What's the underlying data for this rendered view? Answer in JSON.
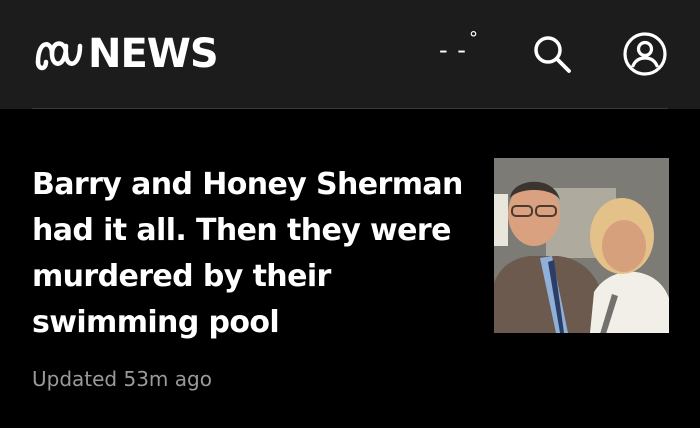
{
  "header": {
    "logo_text": "NEWS",
    "weather": {
      "temperature": "- -",
      "degree_symbol": "°"
    },
    "icons": {
      "logo": "abc-logo-icon",
      "search": "search-icon",
      "account": "account-icon"
    }
  },
  "article": {
    "headline": "Barry and Honey Sherman had it all. Then they were murdered by their swimming pool",
    "timestamp": "Updated 53m ago",
    "thumbnail": "photo of Barry and Honey Sherman"
  },
  "colors": {
    "header_bg": "#1c1c1c",
    "page_bg": "#000000",
    "text": "#ffffff",
    "meta_text": "#9a9a9a"
  }
}
